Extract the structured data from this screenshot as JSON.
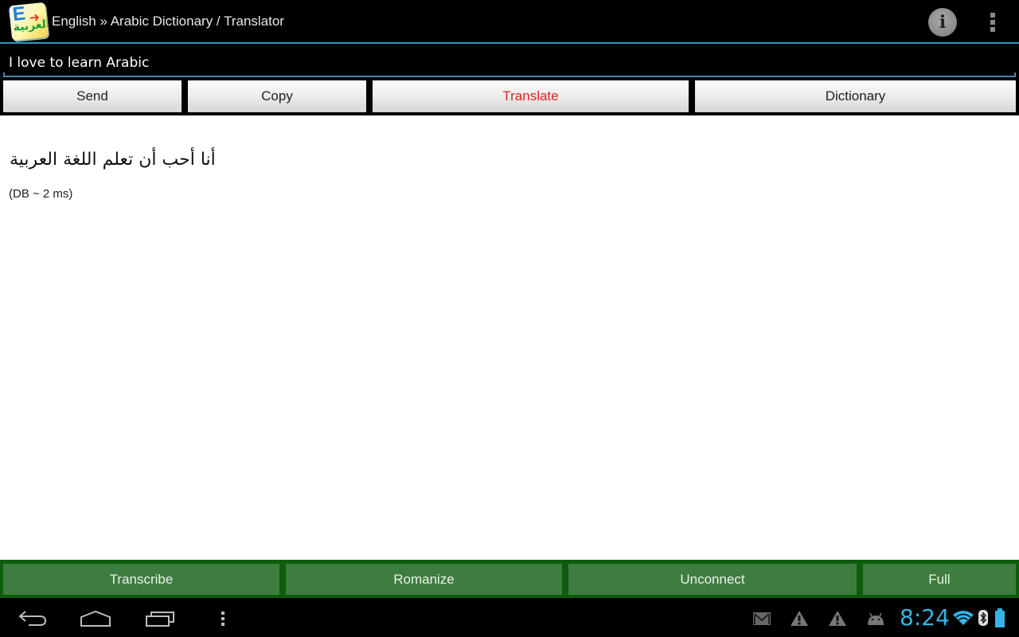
{
  "actionbar": {
    "title": "English » Arabic Dictionary / Translator",
    "app_icon": {
      "letter": "E",
      "arrow": "➜",
      "arabic": "العربية"
    },
    "info_icon": "i",
    "accent_color": "#33b5e5"
  },
  "input": {
    "value": "I love to learn Arabic",
    "placeholder": ""
  },
  "top_buttons": [
    {
      "label": "Send",
      "active": false
    },
    {
      "label": "Copy",
      "active": false
    },
    {
      "label": "Translate",
      "active": true
    },
    {
      "label": "Dictionary",
      "active": false
    }
  ],
  "result": {
    "translation": "أنا أحب أن تعلم اللغة العربية",
    "timing": "(DB ~ 2 ms)"
  },
  "bottom_buttons": [
    {
      "label": "Transcribe"
    },
    {
      "label": "Romanize"
    },
    {
      "label": "Unconnect"
    },
    {
      "label": "Full"
    }
  ],
  "status_bar": {
    "time": "8:24",
    "notifications": [
      "gmail-icon",
      "warning-icon",
      "warning-icon",
      "android-debug-icon"
    ],
    "indicators": [
      "wifi-icon",
      "bluetooth-icon",
      "battery-icon"
    ]
  },
  "colors": {
    "active_button_text": "#dd2222",
    "green_button": "#3f7c3f",
    "green_bar": "#0c5c0c",
    "clock": "#33b5e5"
  }
}
